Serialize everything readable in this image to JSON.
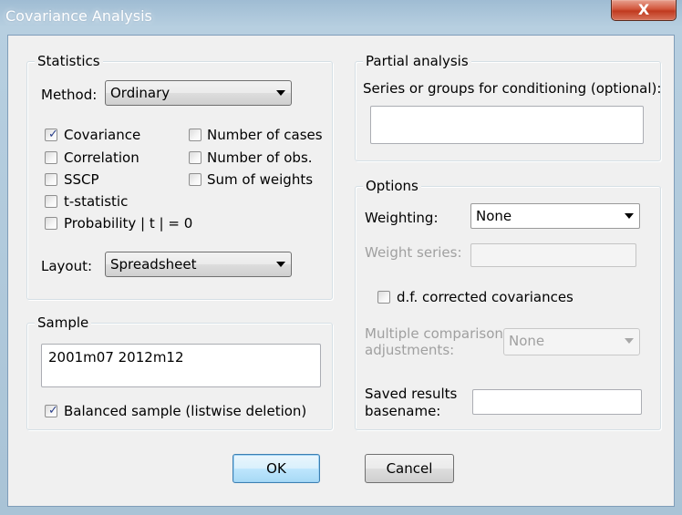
{
  "window": {
    "title": "Covariance Analysis",
    "close_label": "X"
  },
  "statistics": {
    "legend": "Statistics",
    "method_label": "Method:",
    "method_value": "Ordinary",
    "checks_left": [
      {
        "label": "Covariance",
        "checked": true
      },
      {
        "label": "Correlation",
        "checked": false
      },
      {
        "label": "SSCP",
        "checked": false
      },
      {
        "label": "t-statistic",
        "checked": false
      },
      {
        "label": "Probability | t | = 0",
        "checked": false
      }
    ],
    "checks_right": [
      {
        "label": "Number of cases",
        "checked": false
      },
      {
        "label": "Number of obs.",
        "checked": false
      },
      {
        "label": "Sum of weights",
        "checked": false
      }
    ],
    "layout_label": "Layout:",
    "layout_value": "Spreadsheet"
  },
  "sample": {
    "legend": "Sample",
    "value": "2001m07 2012m12",
    "balanced_label": "Balanced sample (listwise deletion)",
    "balanced_checked": true
  },
  "partial": {
    "legend": "Partial analysis",
    "series_label": "Series or groups for conditioning (optional):",
    "series_value": ""
  },
  "options": {
    "legend": "Options",
    "weighting_label": "Weighting:",
    "weighting_value": "None",
    "weight_series_label": "Weight series:",
    "weight_series_value": "",
    "df_label": "d.f. corrected covariances",
    "df_checked": false,
    "multi_label_1": "Multiple comparison",
    "multi_label_2": "adjustments:",
    "multi_value": "None",
    "saved_label_1": "Saved results",
    "saved_label_2": "basename:",
    "saved_value": ""
  },
  "buttons": {
    "ok": "OK",
    "cancel": "Cancel"
  },
  "check_mark": "✓",
  "colors": {
    "close_red": "#c03a1f",
    "default_button_border": "#3c7fb1",
    "disabled_text": "#a0a0a0"
  }
}
